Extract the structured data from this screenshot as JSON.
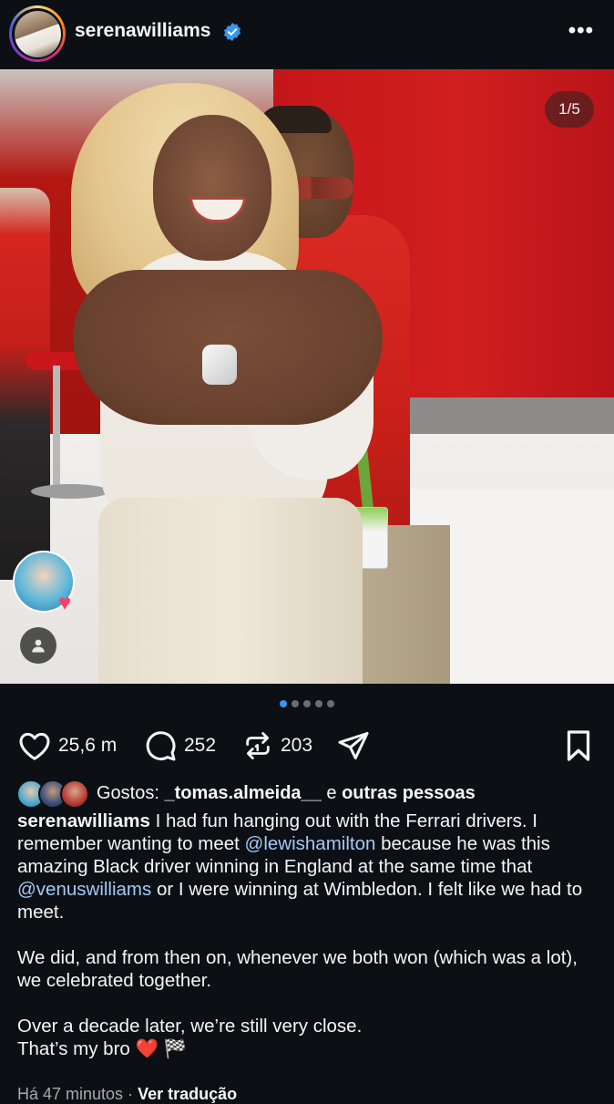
{
  "header": {
    "username": "serenawilliams",
    "more_icon": "more-horizontal-icon"
  },
  "photo": {
    "counter": "1/5",
    "carousel_total": 5,
    "carousel_active": 1
  },
  "actions": {
    "likes_count": "25,6 m",
    "comments_count": "252",
    "reposts_count": "203"
  },
  "likes": {
    "prefix": "Gostos: ",
    "user": "_tomas.almeida__",
    "middle": " e ",
    "others": "outras pessoas"
  },
  "caption": {
    "username": "serenawilliams",
    "p1_a": " I had fun hanging out with the Ferrari drivers. I remember wanting to meet ",
    "mention1": "@lewishamilton",
    "p1_b": " because he was this amazing Black driver winning in England at the same time that ",
    "mention2": "@venuswilliams",
    "p1_c": " or I were winning at Wimbledon. I felt like we had to meet.",
    "p2": "We did, and from then on, whenever we both won (which was a lot), we celebrated together.",
    "p3_line1": "Over a decade later, we’re still very close.",
    "p3_line2": "That’s my bro ❤️ 🏁"
  },
  "footer": {
    "time": "Há 47 minutos · ",
    "translate": "Ver tradução"
  },
  "colors": {
    "background": "#0c1014",
    "mention": "#a4c8f7",
    "verified": "#3797f0"
  }
}
